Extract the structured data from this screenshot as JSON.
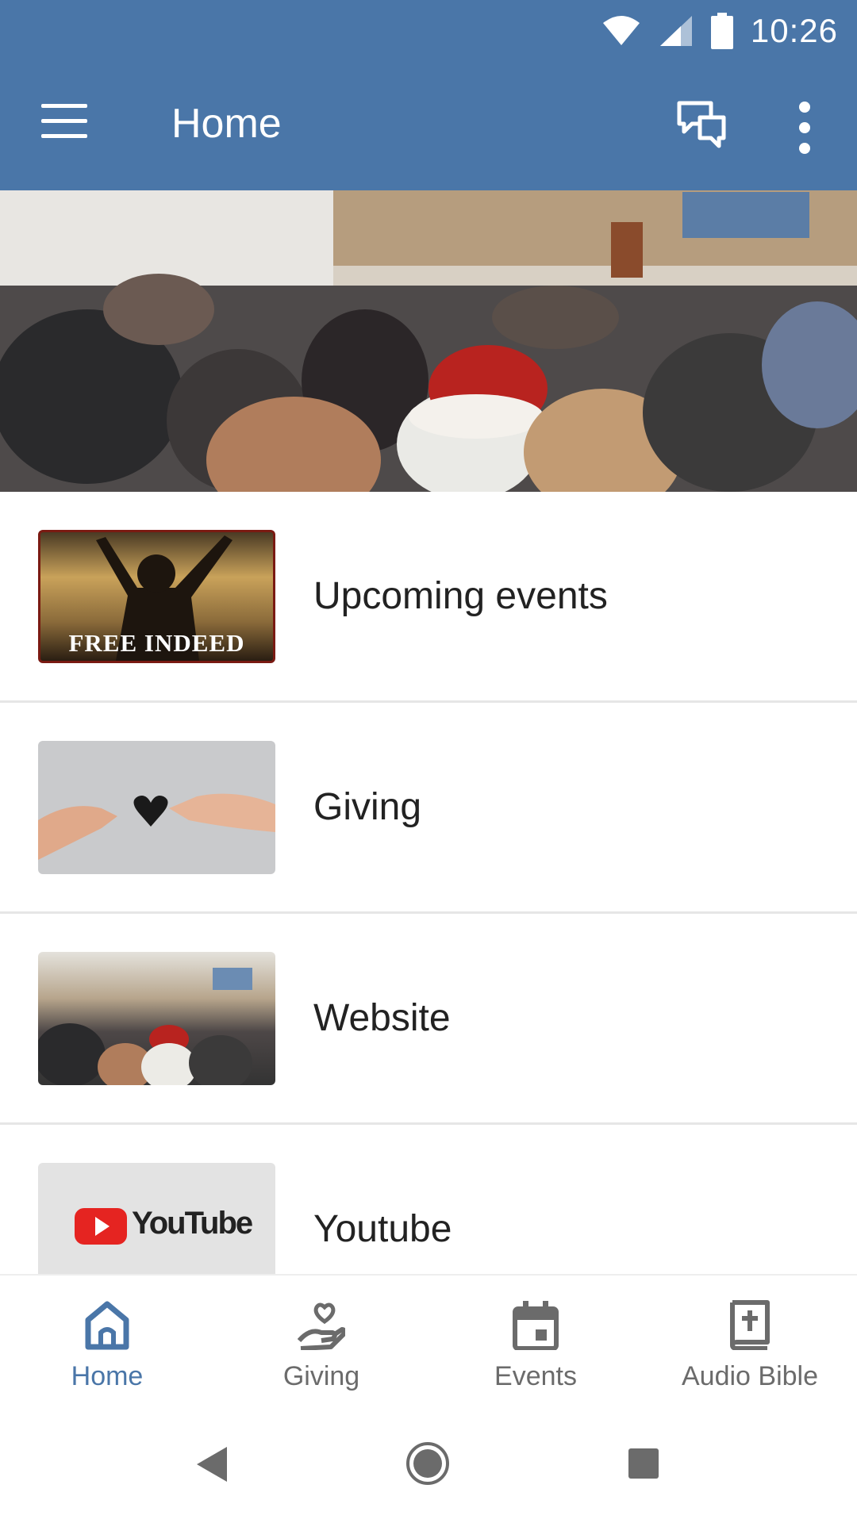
{
  "status_bar": {
    "time": "10:26"
  },
  "app_bar": {
    "title": "Home"
  },
  "list": {
    "items": [
      {
        "label": "Upcoming events",
        "thumb_caption": "FREE INDEED"
      },
      {
        "label": "Giving"
      },
      {
        "label": "Website"
      },
      {
        "label": "Youtube",
        "thumb_caption": "YouTube"
      }
    ]
  },
  "bottom_nav": {
    "items": [
      {
        "label": "Home",
        "icon": "home-icon",
        "active": true
      },
      {
        "label": "Giving",
        "icon": "giving-hand-heart-icon"
      },
      {
        "label": "Events",
        "icon": "calendar-icon"
      },
      {
        "label": "Audio Bible",
        "icon": "bible-cross-icon"
      }
    ]
  },
  "colors": {
    "primary": "#4a76a8",
    "inactive": "#6b6b6b",
    "text": "#222222"
  }
}
